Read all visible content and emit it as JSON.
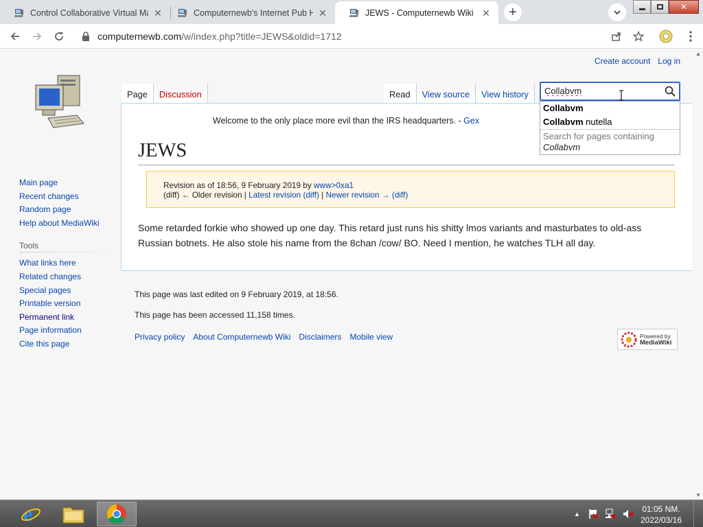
{
  "browser": {
    "tabs": [
      {
        "title": "Control Collaborative Virtual Mac",
        "active": false
      },
      {
        "title": "Computernewb's Internet Pub Hub",
        "active": false
      },
      {
        "title": "JEWS - Computernewb Wiki",
        "active": true
      }
    ],
    "url_host": "computernewb.com",
    "url_path": "/w/index.php?title=JEWS&oldid=1712"
  },
  "wiki": {
    "personal": {
      "create_account": "Create account",
      "login": "Log in"
    },
    "nav_tabs": {
      "page": "Page",
      "discussion": "Discussion",
      "read": "Read",
      "view_source": "View source",
      "view_history": "View history"
    },
    "search": {
      "value": "Collabvm",
      "placeholder": ""
    },
    "suggestions": [
      {
        "bold": "Collabvm",
        "rest": ""
      },
      {
        "bold": "Collabvm",
        "rest": " nutella"
      }
    ],
    "search_containing": {
      "prefix": "Search for pages containing",
      "term": "Collabvm"
    },
    "sitenotice": {
      "text": "Welcome to the only place more evil than the IRS headquarters. - ",
      "link": "Gex"
    },
    "title": "JEWS",
    "revision": {
      "prefix": "Revision as of 18:56, 9 February 2019 by ",
      "user": "www>0xa1",
      "diff1": "(diff)",
      "older": "← Older revision",
      "sep1": " | ",
      "latest": "Latest revision",
      "diff2": "(diff)",
      "sep2": " | ",
      "newer": "Newer revision →",
      "diff3": "(diff)"
    },
    "body": "Some retarded forkie who showed up one day. This retard just runs his shitty lmos variants and masturbates to old-ass Russian botnets. He also stole his name from the 8chan /cow/ BO. Need I mention, he watches TLH all day.",
    "sidebar": {
      "navigation": [
        "Main page",
        "Recent changes",
        "Random page",
        "Help about MediaWiki"
      ],
      "tools_heading": "Tools",
      "tools": [
        "What links here",
        "Related changes",
        "Special pages",
        "Printable version",
        "Permanent link",
        "Page information",
        "Cite this page"
      ]
    },
    "footer": {
      "last_edited": "This page was last edited on 9 February 2019, at 18:56.",
      "accessed": "This page has been accessed 11,158 times.",
      "links": [
        "Privacy policy",
        "About Computernewb Wiki",
        "Disclaimers",
        "Mobile view"
      ],
      "powered_by_1": "Powered by",
      "powered_by_2": "MediaWiki"
    }
  },
  "taskbar": {
    "time": "01:05 NM.",
    "date": "2022/03/16"
  }
}
